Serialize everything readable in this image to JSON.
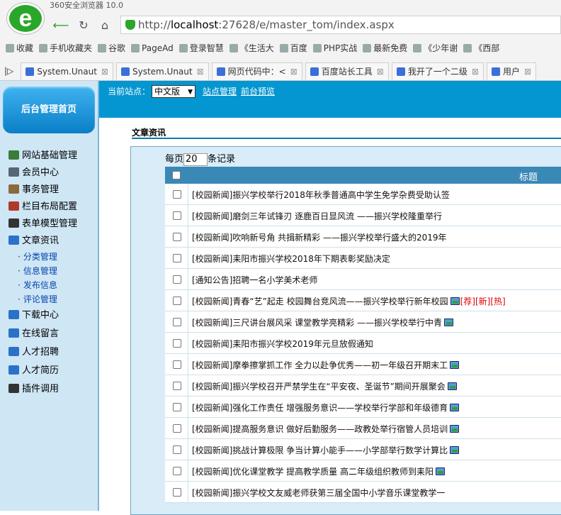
{
  "browser": {
    "title": "360安全浏览器 10.0",
    "url_prefix": "http://",
    "url_host": "localhost",
    "url_rest": ":27628/e/master_tom/index.aspx"
  },
  "bookmarks": [
    "收藏",
    "手机收藏夹",
    "谷歌",
    "PageAd",
    "登录智慧",
    "《生活大",
    "百度",
    "PHP实战",
    "最新免费",
    "《少年谢",
    "《西部"
  ],
  "tabs": [
    {
      "label": "System.Unaut"
    },
    {
      "label": "System.Unaut"
    },
    {
      "label": "网页代码中：<"
    },
    {
      "label": "百度站长工具"
    },
    {
      "label": "我开了一个二级"
    },
    {
      "label": "用户"
    }
  ],
  "sidebar": {
    "home": "后台管理首页",
    "menu": [
      {
        "label": "网站基础管理",
        "color": "#3a7d3a"
      },
      {
        "label": "会员中心",
        "color": "#556677"
      },
      {
        "label": "事务管理",
        "color": "#8a6a3a"
      },
      {
        "label": "栏目布局配置",
        "color": "#b03a2a"
      },
      {
        "label": "表单模型管理",
        "color": "#333333"
      },
      {
        "label": "文章资讯",
        "color": "#2a72c8"
      }
    ],
    "sub": [
      "分类管理",
      "信息管理",
      "发布信息",
      "评论管理"
    ],
    "menu2": [
      {
        "label": "下载中心",
        "color": "#2a72c8"
      },
      {
        "label": "在线留言",
        "color": "#2a72c8"
      },
      {
        "label": "人才招聘",
        "color": "#2a72c8"
      },
      {
        "label": "人才简历",
        "color": "#2a72c8"
      },
      {
        "label": "插件调用",
        "color": "#333333"
      }
    ]
  },
  "topbar": {
    "site_label": "当前站点：",
    "site_value": "中文版",
    "site_manage": "站点管理",
    "preview": "前台预览"
  },
  "content": {
    "section_title": "文章资讯",
    "perpage_prefix": "每页",
    "perpage_value": "20",
    "perpage_suffix": "条记录",
    "col_title": "标题",
    "rows": [
      {
        "text": "[校园新闻]振兴学校举行2018年秋季普通高中学生免学杂费受助认签",
        "pic": false
      },
      {
        "text": "[校园新闻]磨剑三年试锋刃 逐鹿百日显风流 ——振兴学校隆重举行",
        "pic": false
      },
      {
        "text": "[校园新闻]吹响新号角 共揖新精彩 ——振兴学校举行盛大的2019年",
        "pic": false
      },
      {
        "text": "[校园新闻]耒阳市振兴学校2018年下期表彰奖励决定",
        "pic": false
      },
      {
        "text": "[通知公告]招聘一名小学美术老师",
        "pic": false
      },
      {
        "text": "[校园新闻]青春“艺”起走 校园舞台竞风流——振兴学校举行新年校园",
        "pic": true,
        "tags": "[荐][新][热]"
      },
      {
        "text": "[校园新闻]三尺讲台展风采 课堂教学亮精彩 ——振兴学校举行中青",
        "pic": true
      },
      {
        "text": "[校园新闻]耒阳市振兴学校2019年元旦放假通知",
        "pic": false
      },
      {
        "text": "[校园新闻]摩拳擦掌抓工作 全力以赴争优秀——初一年级召开期末工",
        "pic": true
      },
      {
        "text": "[校园新闻]振兴学校召开严禁学生在“平安夜、圣诞节”期间开展聚会",
        "pic": true
      },
      {
        "text": "[校园新闻]强化工作责任 增强服务意识——学校举行学部和年级德育",
        "pic": true
      },
      {
        "text": "[校园新闻]提高服务意识 做好后勤服务——政教处举行宿管人员培训",
        "pic": true
      },
      {
        "text": "[校园新闻]挑战计算极限 争当计算小能手——小学部举行数学计算比",
        "pic": true
      },
      {
        "text": "[校园新闻]优化课堂教学 提高教学质量 高二年级组织教师到耒阳",
        "pic": true
      },
      {
        "text": "[校园新闻]振兴学校文友威老师获第三届全国中小学音乐课堂教学一",
        "pic": false
      }
    ]
  }
}
